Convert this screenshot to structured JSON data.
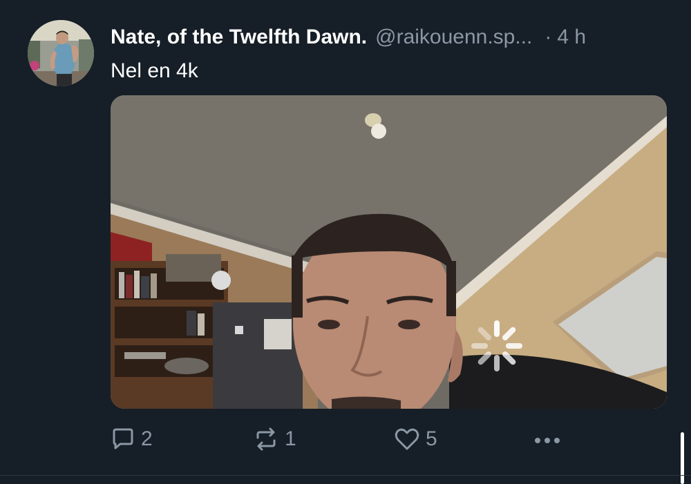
{
  "post": {
    "author": {
      "display_name": "Nate, of the Twelfth Dawn.",
      "handle": "@raikouenn.sp...",
      "avatar_icon": "avatar-photo"
    },
    "separator": "·",
    "timestamp": "4 h",
    "text": "Nel en 4k",
    "media": {
      "kind": "video",
      "state": "loading",
      "spinner_icon": "loading-spinner-icon"
    },
    "actions": {
      "reply": {
        "icon": "reply-icon",
        "count": "2"
      },
      "repost": {
        "icon": "repost-icon",
        "count": "1"
      },
      "like": {
        "icon": "heart-icon",
        "count": "5"
      },
      "more": {
        "icon": "more-options-icon"
      }
    }
  },
  "colors": {
    "background": "#161e27",
    "primary_text": "#ffffff",
    "secondary_text": "#8b98a5",
    "divider": "#2c3640"
  }
}
